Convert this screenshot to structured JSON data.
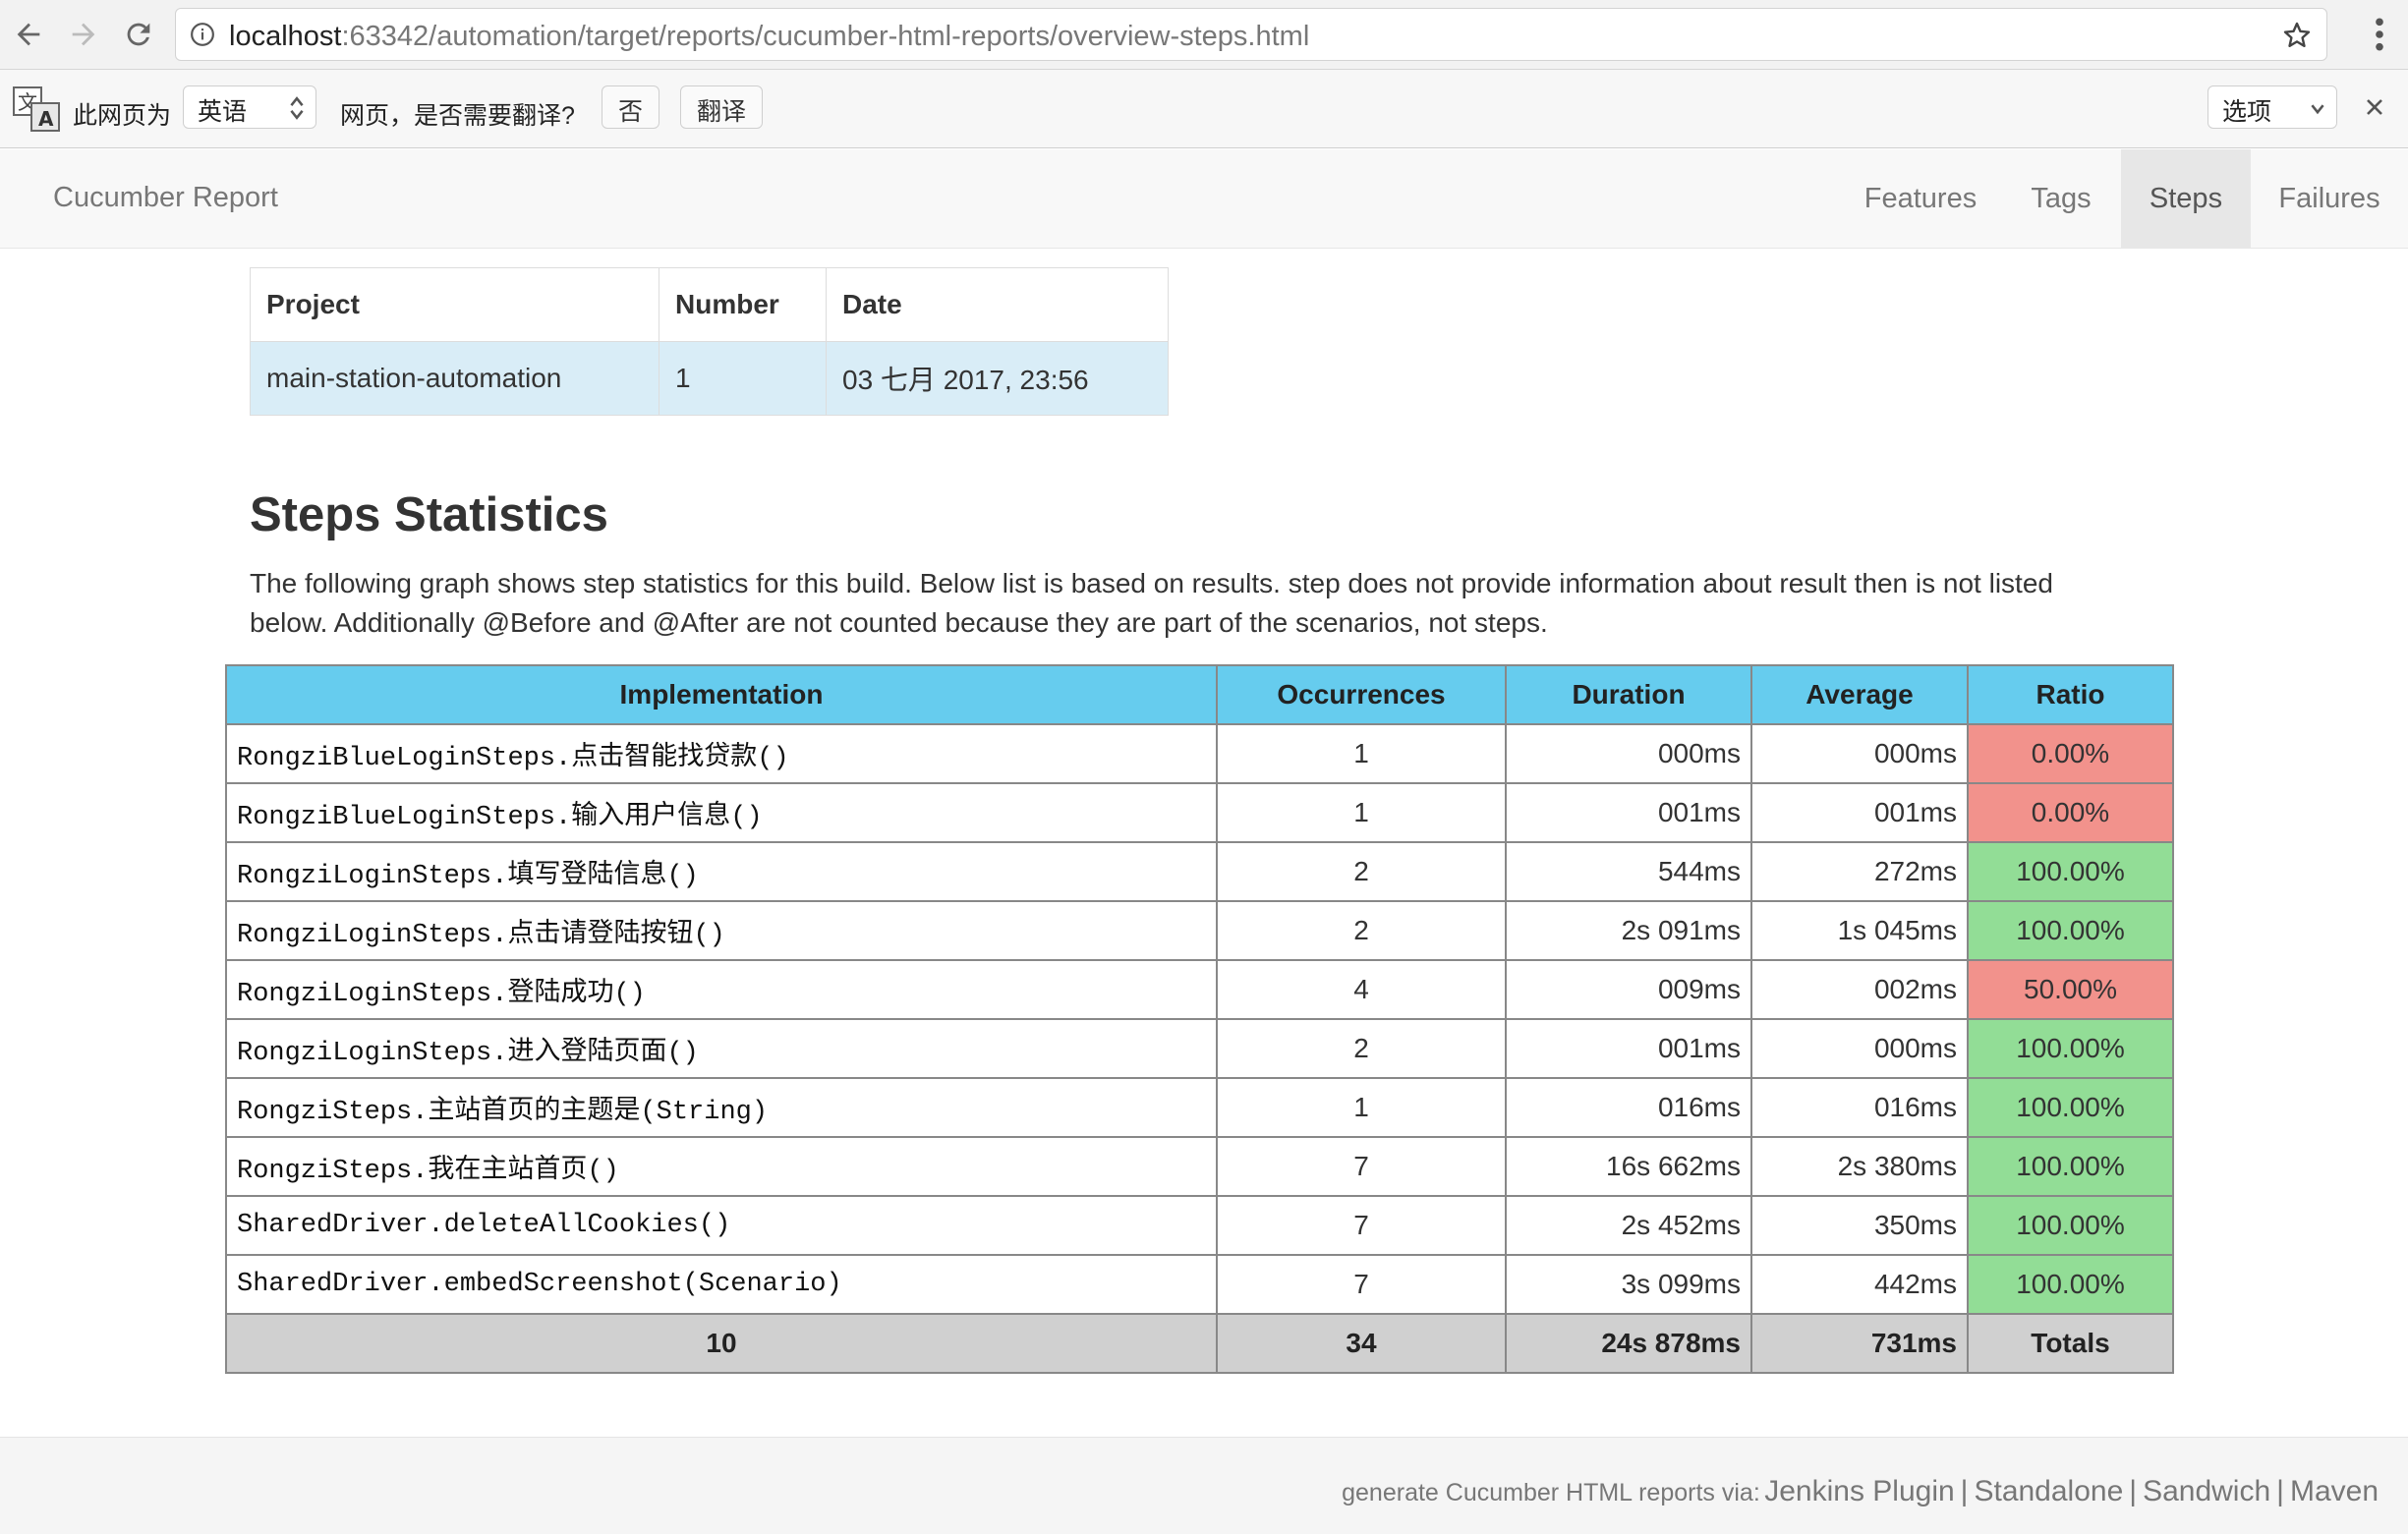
{
  "browser": {
    "url_host": "localhost",
    "url_rest": ":63342/automation/target/reports/cucumber-html-reports/overview-steps.html"
  },
  "translate_bar": {
    "prefix": "此网页为",
    "language": "英语",
    "question": "网页，是否需要翻译?",
    "no_label": "否",
    "translate_label": "翻译",
    "options_label": "选项"
  },
  "navbar": {
    "brand": "Cucumber Report",
    "items": [
      {
        "label": "Features"
      },
      {
        "label": "Tags"
      },
      {
        "label": "Steps",
        "active": true
      },
      {
        "label": "Failures"
      }
    ]
  },
  "info": {
    "headers": [
      "Project",
      "Number",
      "Date"
    ],
    "row": [
      "main-station-automation",
      "1",
      "03 七月 2017, 23:56"
    ]
  },
  "page": {
    "title": "Steps Statistics",
    "description": "The following graph shows step statistics for this build. Below list is based on results. step does not provide information about result then is not listed below. Additionally @Before and @After are not counted because they are part of the scenarios, not steps."
  },
  "stats": {
    "headers": [
      "Implementation",
      "Occurrences",
      "Duration",
      "Average",
      "Ratio"
    ],
    "rows": [
      {
        "impl": "RongziBlueLoginSteps.点击智能找贷款()",
        "occ": "1",
        "dur": "000ms",
        "avg": "000ms",
        "ratio": "0.00%",
        "status": "bad"
      },
      {
        "impl": "RongziBlueLoginSteps.输入用户信息()",
        "occ": "1",
        "dur": "001ms",
        "avg": "001ms",
        "ratio": "0.00%",
        "status": "bad"
      },
      {
        "impl": "RongziLoginSteps.填写登陆信息()",
        "occ": "2",
        "dur": "544ms",
        "avg": "272ms",
        "ratio": "100.00%",
        "status": "ok"
      },
      {
        "impl": "RongziLoginSteps.点击请登陆按钮()",
        "occ": "2",
        "dur": "2s 091ms",
        "avg": "1s 045ms",
        "ratio": "100.00%",
        "status": "ok"
      },
      {
        "impl": "RongziLoginSteps.登陆成功()",
        "occ": "4",
        "dur": "009ms",
        "avg": "002ms",
        "ratio": "50.00%",
        "status": "bad"
      },
      {
        "impl": "RongziLoginSteps.进入登陆页面()",
        "occ": "2",
        "dur": "001ms",
        "avg": "000ms",
        "ratio": "100.00%",
        "status": "ok"
      },
      {
        "impl": "RongziSteps.主站首页的主题是(String)",
        "occ": "1",
        "dur": "016ms",
        "avg": "016ms",
        "ratio": "100.00%",
        "status": "ok"
      },
      {
        "impl": "RongziSteps.我在主站首页()",
        "occ": "7",
        "dur": "16s 662ms",
        "avg": "2s 380ms",
        "ratio": "100.00%",
        "status": "ok"
      },
      {
        "impl": "SharedDriver.deleteAllCookies()",
        "occ": "7",
        "dur": "2s 452ms",
        "avg": "350ms",
        "ratio": "100.00%",
        "status": "ok"
      },
      {
        "impl": "SharedDriver.embedScreenshot(Scenario)",
        "occ": "7",
        "dur": "3s 099ms",
        "avg": "442ms",
        "ratio": "100.00%",
        "status": "ok"
      }
    ],
    "totals": {
      "impl": "10",
      "occ": "34",
      "dur": "24s 878ms",
      "avg": "731ms",
      "label": "Totals"
    }
  },
  "colors": {
    "header_blue": "#66ccee",
    "passed_green": "#92dd96",
    "failed_red": "#f2928c",
    "totals_gray": "#d0d0d0"
  },
  "footer": {
    "lead": "generate Cucumber HTML reports via:",
    "links": [
      "Jenkins Plugin",
      "Standalone",
      "Sandwich",
      "Maven"
    ],
    "separator": "|"
  }
}
